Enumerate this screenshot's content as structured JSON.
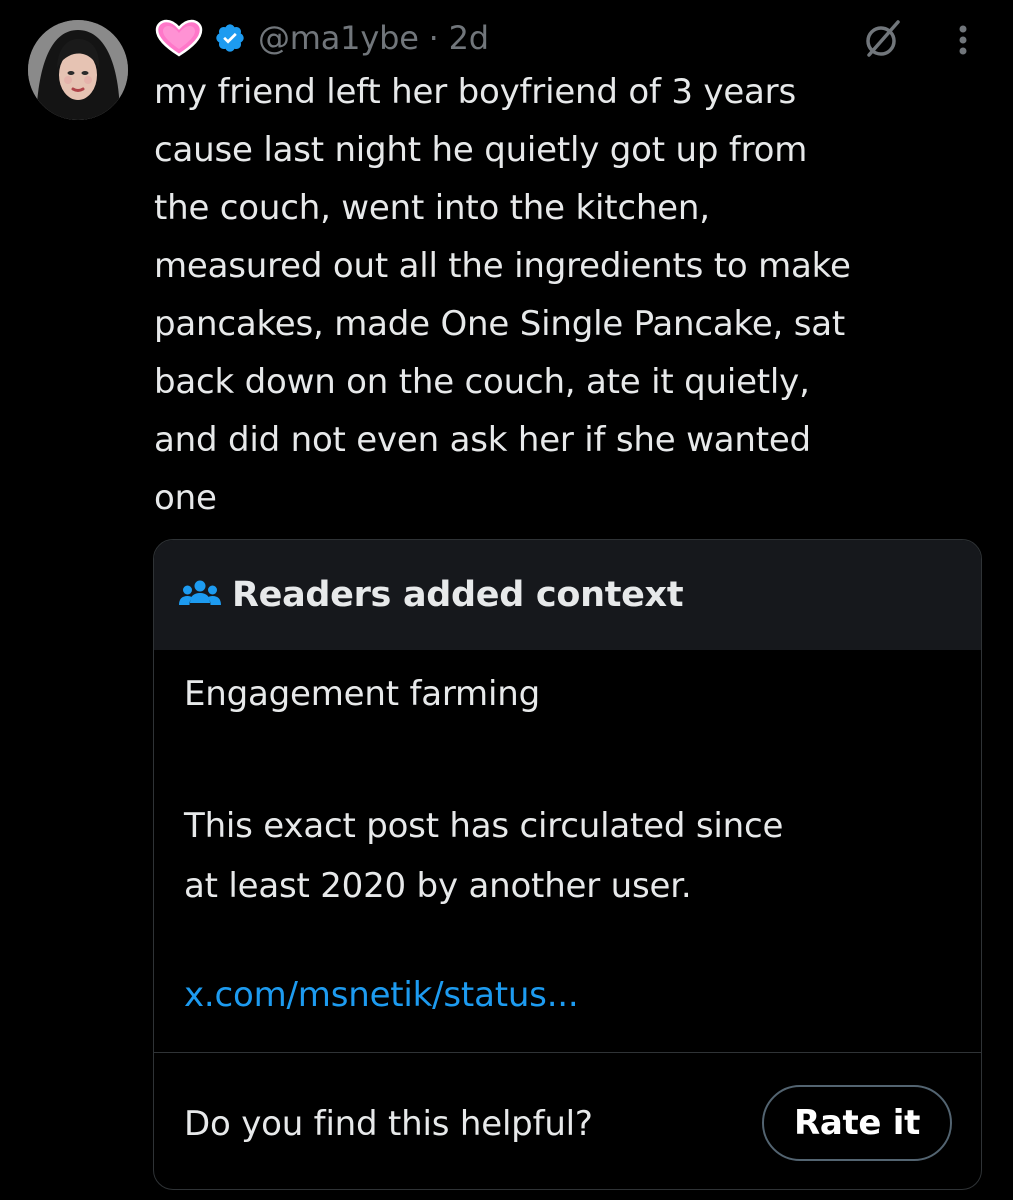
{
  "post": {
    "handle": "@ma1ybe",
    "separator": "·",
    "age": "2d",
    "text": "my friend left her boyfriend of 3 years\ncause last night he quietly got up from\nthe couch, went into the kitchen,\nmeasured out all the ingredients to make\npancakes, made One Single Pancake, sat\nback down on the couch, ate it quietly,\nand did not even ask her if she wanted\none",
    "badges": [
      "pink-heart-icon",
      "verified-badge-icon"
    ]
  },
  "note": {
    "header_title": "Readers added context",
    "label": "Engagement farming",
    "description": "This exact post has circulated since\nat least 2020 by another user.",
    "link": "x.com/msnetik/status...",
    "question": "Do you find this helpful?",
    "rate_label": "Rate it"
  },
  "colors": {
    "background": "#000000",
    "text": "#e7e9ea",
    "secondary": "#71767b",
    "link": "#1d9bf0",
    "verified": "#1d9bf0",
    "note_header_bg": "#16181c",
    "border": "#2f3336"
  }
}
